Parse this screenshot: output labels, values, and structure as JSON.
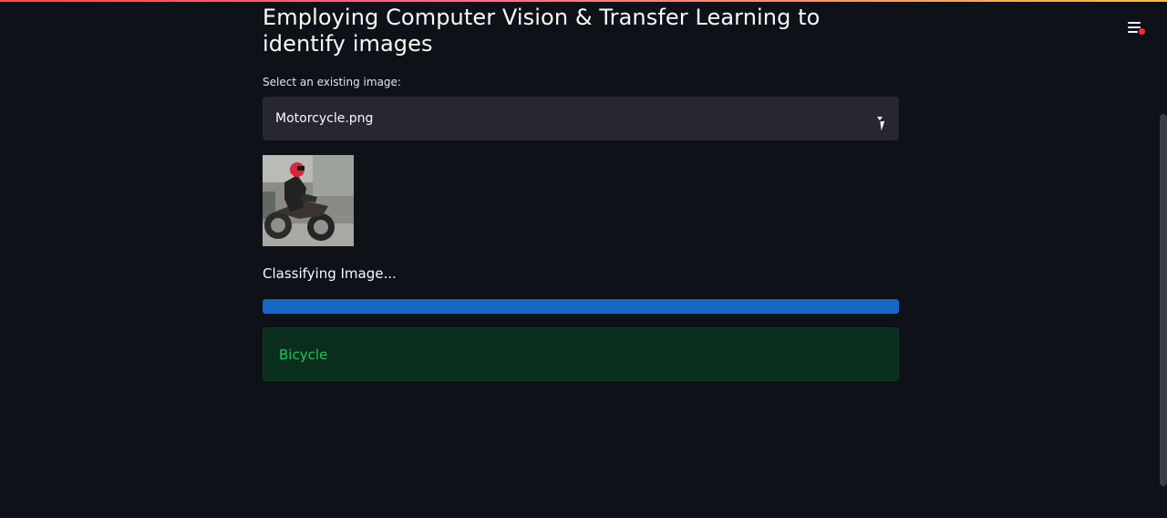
{
  "header": {
    "title": "Employing Computer Vision & Transfer Learning to identify images"
  },
  "select": {
    "label": "Select an existing image:",
    "value": "Motorcycle.png"
  },
  "image": {
    "alt": "Motorcycle.png"
  },
  "status": {
    "text": "Classifying Image..."
  },
  "progress": {
    "value_fraction": 1.0
  },
  "result": {
    "text": "Bicycle"
  },
  "colors": {
    "background": "#0e1117",
    "select_bg": "#262730",
    "progress": "#1268c4",
    "success_bg": "#0a2e1c",
    "success_text": "#21c45d",
    "notification_dot": "#ff2b2b"
  },
  "icons": {
    "menu": "hamburger-menu-icon",
    "caret": "chevron-down-icon"
  }
}
